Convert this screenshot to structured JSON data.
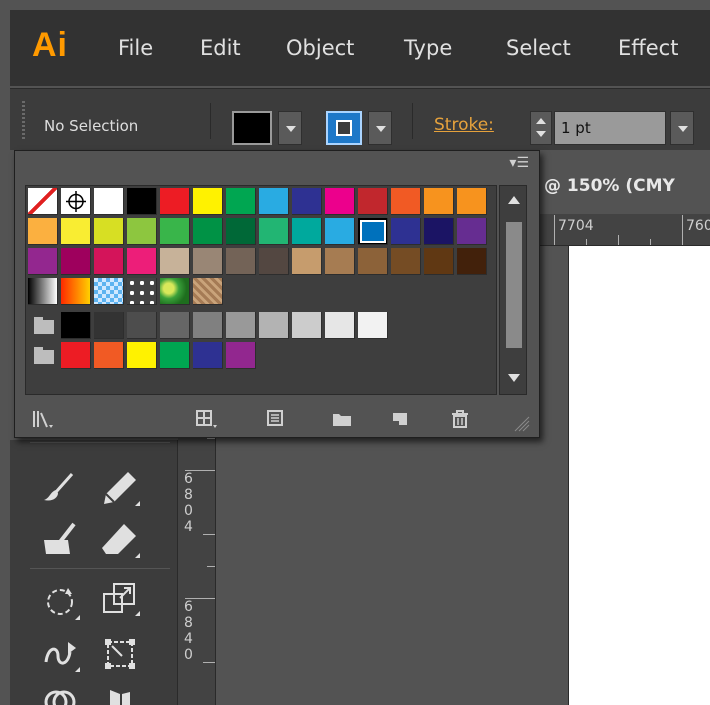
{
  "app": {
    "logo": "Ai",
    "accent": "#ff9a00"
  },
  "menu": [
    "File",
    "Edit",
    "Object",
    "Type",
    "Select",
    "Effect"
  ],
  "control_bar": {
    "selection_status": "No Selection",
    "fill_color": "#000000",
    "stroke_label": "Stroke:",
    "stroke_weight": "1 pt"
  },
  "document": {
    "title": "@ 150% (CMY",
    "ruler_top": [
      "7704",
      "760"
    ],
    "ruler_left": [
      "6",
      "8",
      "0",
      "4",
      "6",
      "8",
      "4",
      "0"
    ]
  },
  "swatches": {
    "rows": [
      [
        "none",
        "registration",
        "#ffffff",
        "#000000",
        "#ed1c24",
        "#fff200",
        "#00a651",
        "#29abe2",
        "#2e3192",
        "#ec008c",
        "#c1272d",
        "#f15a24",
        "#f7931e",
        "#f7931e"
      ],
      [
        "#fbb040",
        "#f9ed32",
        "#d7df23",
        "#8dc63f",
        "#39b54a",
        "#009245",
        "#006837",
        "#22b573",
        "#00a99d",
        "#29abe2",
        "#0071bc",
        "#2e3192",
        "#1b1464",
        "#662d91"
      ],
      [
        "#93278f",
        "#9e005d",
        "#d4145a",
        "#ed1e79",
        "#c7b299",
        "#998675",
        "#736357",
        "#534741",
        "#c69c6d",
        "#a67c52",
        "#8c6239",
        "#754c24",
        "#603813",
        "#42210b"
      ],
      [
        "gradient-bw",
        "gradient-orange",
        "pattern-blue",
        "pattern-dots",
        "pattern-leaf",
        "pattern-texture"
      ],
      [
        "folder",
        "#000000",
        "#333333",
        "#4d4d4d",
        "#666666",
        "#808080",
        "#999999",
        "#b3b3b3",
        "#cccccc",
        "#e6e6e6",
        "#f2f2f2"
      ],
      [
        "folder",
        "#ed1c24",
        "#f15a24",
        "#fff200",
        "#00a651",
        "#2e3192",
        "#92278f"
      ]
    ],
    "selected_color": "#0071bc",
    "footer_icons": [
      "swatch-libraries-menu-icon",
      "show-swatch-kinds-icon",
      "swatch-options-icon",
      "new-color-group-icon",
      "new-swatch-icon",
      "delete-swatch-icon"
    ]
  },
  "tools": [
    "paintbrush-tool",
    "pencil-tool",
    "blob-brush-tool",
    "eraser-tool",
    "rotate-tool",
    "scale-tool",
    "warp-tool",
    "free-transform-tool",
    "shape-builder-tool",
    "perspective-grid-tool"
  ]
}
